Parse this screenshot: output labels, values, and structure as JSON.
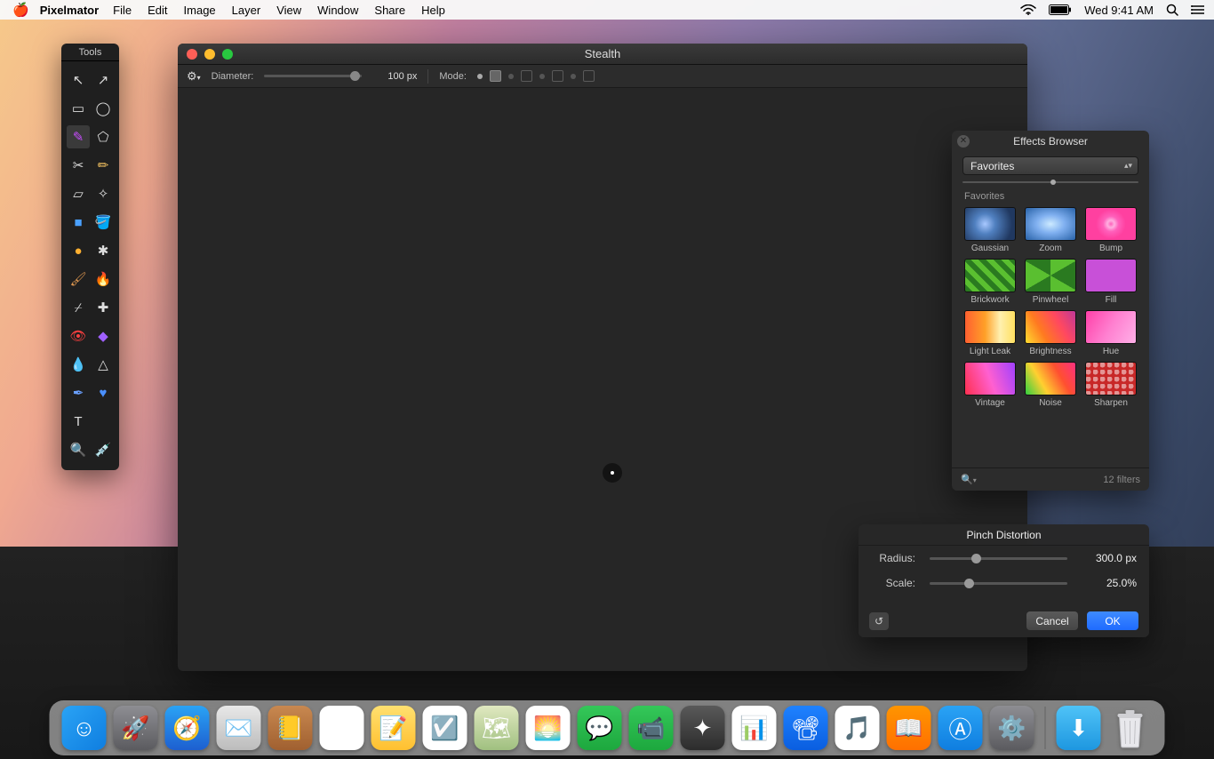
{
  "menubar": {
    "app": "Pixelmator",
    "items": [
      "File",
      "Edit",
      "Image",
      "Layer",
      "View",
      "Window",
      "Share",
      "Help"
    ],
    "clock": "Wed 9:41 AM"
  },
  "tools_panel": {
    "title": "Tools"
  },
  "document": {
    "title": "Stealth",
    "toolbar": {
      "diameter_label": "Diameter:",
      "diameter_value": "100 px",
      "mode_label": "Mode:"
    }
  },
  "effects_browser": {
    "title": "Effects Browser",
    "dropdown": "Favorites",
    "section_label": "Favorites",
    "items": [
      {
        "name": "Gaussian",
        "cls": "th-gaussian"
      },
      {
        "name": "Zoom",
        "cls": "th-zoom"
      },
      {
        "name": "Bump",
        "cls": "th-bump"
      },
      {
        "name": "Brickwork",
        "cls": "th-brickwork"
      },
      {
        "name": "Pinwheel",
        "cls": "th-pinwheel"
      },
      {
        "name": "Fill",
        "cls": "th-fill"
      },
      {
        "name": "Light Leak",
        "cls": "th-lightleak"
      },
      {
        "name": "Brightness",
        "cls": "th-brightness"
      },
      {
        "name": "Hue",
        "cls": "th-hue"
      },
      {
        "name": "Vintage",
        "cls": "th-vintage"
      },
      {
        "name": "Noise",
        "cls": "th-noise"
      },
      {
        "name": "Sharpen",
        "cls": "th-sharpen"
      }
    ],
    "filter_count": "12 filters"
  },
  "effect_hud": {
    "title": "Pinch Distortion",
    "radius_label": "Radius:",
    "radius_value": "300.0 px",
    "scale_label": "Scale:",
    "scale_value": "25.0%",
    "cancel": "Cancel",
    "ok": "OK"
  },
  "dock": {
    "apps": [
      {
        "name": "finder",
        "bg": "linear-gradient(135deg,#2aa3f5,#0f7ee0)",
        "glyph": "☺"
      },
      {
        "name": "launchpad",
        "bg": "linear-gradient(#8e8e93,#5b5b5f)",
        "glyph": "🚀"
      },
      {
        "name": "safari",
        "bg": "linear-gradient(#2aa3f5,#1d5fd0)",
        "glyph": "🧭"
      },
      {
        "name": "mail",
        "bg": "linear-gradient(#e8e8e8,#bcbcbc)",
        "glyph": "✉️"
      },
      {
        "name": "contacts",
        "bg": "linear-gradient(#c88850,#a06030)",
        "glyph": "📒"
      },
      {
        "name": "calendar",
        "bg": "#fff",
        "glyph": "🗓"
      },
      {
        "name": "notes",
        "bg": "linear-gradient(#ffe070,#ffc030)",
        "glyph": "📝"
      },
      {
        "name": "reminders",
        "bg": "#fff",
        "glyph": "☑️"
      },
      {
        "name": "maps",
        "bg": "linear-gradient(#e0e8c0,#a0c080)",
        "glyph": "🗺"
      },
      {
        "name": "photos",
        "bg": "#fff",
        "glyph": "🌅"
      },
      {
        "name": "messages",
        "bg": "linear-gradient(#34c759,#1da83e)",
        "glyph": "💬"
      },
      {
        "name": "facetime",
        "bg": "linear-gradient(#34c759,#1da83e)",
        "glyph": "📹"
      },
      {
        "name": "pixelmator",
        "bg": "linear-gradient(#595959,#2c2c2c)",
        "glyph": "✦"
      },
      {
        "name": "numbers",
        "bg": "#fff",
        "glyph": "📊"
      },
      {
        "name": "keynote",
        "bg": "linear-gradient(#1f82ff,#0a5ee0)",
        "glyph": "📽"
      },
      {
        "name": "itunes",
        "bg": "#fff",
        "glyph": "🎵"
      },
      {
        "name": "ibooks",
        "bg": "linear-gradient(#ff9500,#ff7000)",
        "glyph": "📖"
      },
      {
        "name": "appstore",
        "bg": "linear-gradient(#2aa3f5,#0f7ee0)",
        "glyph": "Ⓐ"
      },
      {
        "name": "systemprefs",
        "bg": "linear-gradient(#8e8e93,#5b5b5f)",
        "glyph": "⚙️"
      }
    ],
    "right": [
      {
        "name": "downloads",
        "bg": "linear-gradient(#4fc3f7,#1e97e0)",
        "glyph": "⬇"
      }
    ]
  }
}
